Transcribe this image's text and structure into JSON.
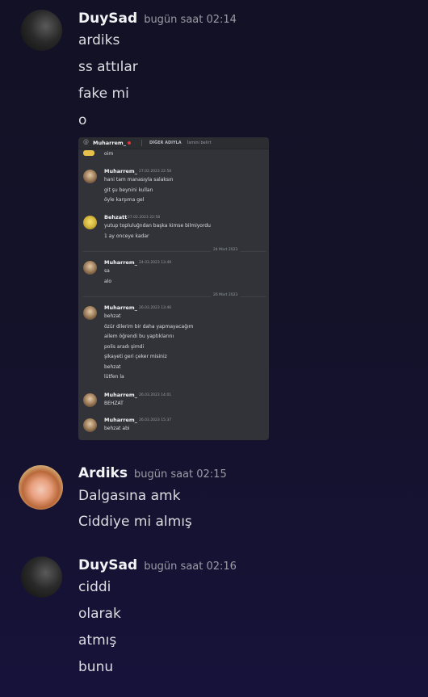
{
  "messages": [
    {
      "username": "DuySad",
      "timestamp": "bugün saat 02:14",
      "lines": [
        "ardiks",
        "ss attılar",
        "fake mi",
        "o"
      ]
    },
    {
      "username": "Ardiks",
      "timestamp": "bugün saat 02:15",
      "lines": [
        "Dalgasına amk",
        "Ciddiye mi almış"
      ]
    },
    {
      "username": "DuySad",
      "timestamp": "bugün saat 02:16",
      "lines": [
        "ciddi",
        "olarak",
        "atmış",
        "bunu"
      ]
    }
  ],
  "screenshot": {
    "header": {
      "at_symbol": "@",
      "channel_name": "Muharrem_",
      "other_names_label": "DİĞER ADIYLA",
      "nickname_placeholder": "İsmini belirt"
    },
    "first_line": "oim",
    "blocks": [
      {
        "author": "Muharrem_",
        "time": "27.02.2023 22:58",
        "lines": [
          "hani tam manasıyla salaksın",
          "git şu beynini kullan",
          "öyle karşıma gel"
        ]
      },
      {
        "author": "Behzatt",
        "time": "27.02.2023 22:58",
        "lines": [
          "yutup topluluğndan başka kimse bilmiyordu",
          "1 ay onceye kadar"
        ]
      },
      {
        "divider": "24 Mart 2023"
      },
      {
        "author": "Muharrem_",
        "time": "24.03.2023 13:49",
        "lines": [
          "sa",
          "alo"
        ]
      },
      {
        "divider": "26 Mart 2023"
      },
      {
        "author": "Muharrem_",
        "time": "26.03.2023 13:46",
        "lines": [
          "behzat",
          "özür dilerim bir daha yapmayacağım",
          "ailem öğrendi bu yaptıklarını",
          "polis aradı şimdi",
          "şikayeti geri çeker misiniz",
          "behzat",
          "lütfen la"
        ]
      },
      {
        "author": "Muharrem_",
        "time": "26.03.2023 14:01",
        "lines": [
          "BEHZAT"
        ]
      },
      {
        "author": "Muharrem_",
        "time": "26.03.2023 15:37",
        "lines": [
          "behzat abi"
        ]
      }
    ]
  }
}
